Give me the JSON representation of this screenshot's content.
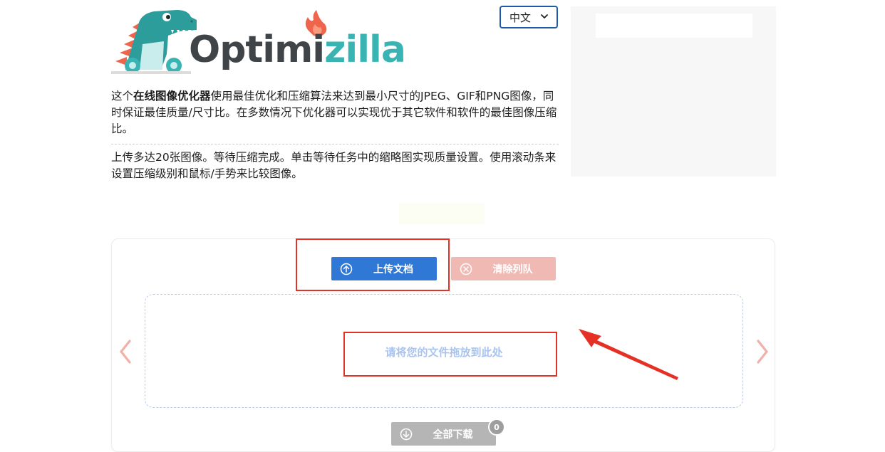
{
  "brand": {
    "logo_part_1": "Optimi",
    "logo_part_2": "zilla",
    "dark_color": "#3f4448",
    "teal_color": "#3ab3b3",
    "flame_color": "#f0644c"
  },
  "language": {
    "selected": "中文",
    "icon": "chevron-down-icon"
  },
  "intro": {
    "prefix": "这个",
    "bold": "在线图像优化器",
    "rest": "使用最佳优化和压缩算法来达到最小尺寸的JPEG、GIF和PNG图像，同时保证最佳质量/尺寸比。在多数情况下优化器可以实现优于其它软件和软件的最佳图像压缩比。"
  },
  "instructions": "上传多达20张图像。等待压缩完成。单击等待任务中的缩略图实现质量设置。使用滚动条来设置压缩级别和鼠标/手势来比较图像。",
  "uploader": {
    "upload_label": "上传文档",
    "upload_icon": "arrow-up-circle-icon",
    "clear_label": "清除列队",
    "clear_icon": "close-circle-icon",
    "drop_text": "请将您的文件拖放到此处",
    "download_all_label": "全部下载",
    "download_icon": "arrow-down-circle-icon",
    "download_count": "0",
    "prev_icon": "chevron-left-icon",
    "next_icon": "chevron-right-icon"
  },
  "colors": {
    "upload_button": "#2f78d5",
    "clear_button": "#f1b9b3",
    "download_button": "#b5b5b5",
    "annotation": "#e53125"
  }
}
